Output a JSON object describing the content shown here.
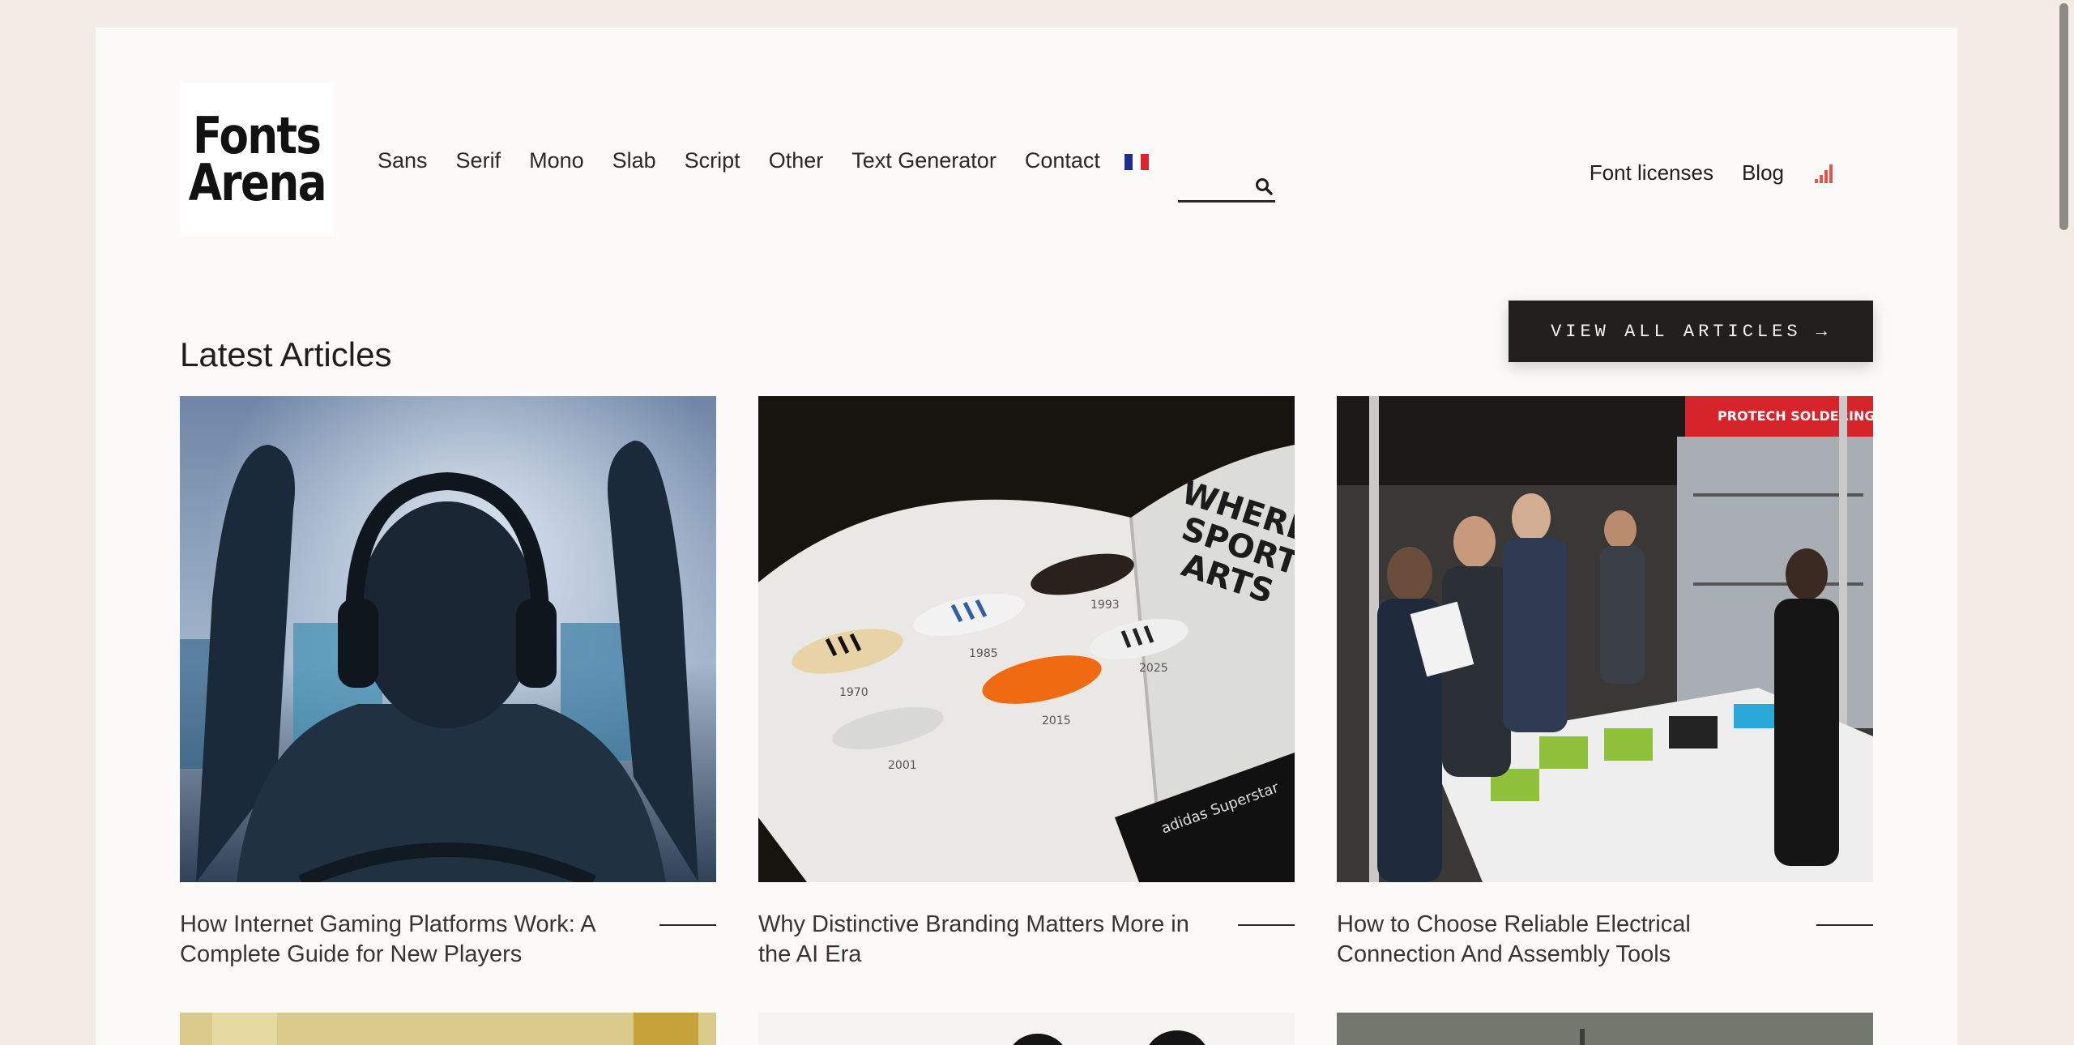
{
  "logo": {
    "line1": "Fonts",
    "line2": "Arena"
  },
  "nav": {
    "items": [
      "Sans",
      "Serif",
      "Mono",
      "Slab",
      "Script",
      "Other",
      "Text Generator",
      "Contact"
    ]
  },
  "language_flag": {
    "icon": "french-flag-icon",
    "colors": [
      "#1e2d8c",
      "#ffffff",
      "#e0222a"
    ]
  },
  "search": {
    "value": "",
    "placeholder": "",
    "icon": "search-icon"
  },
  "right_nav": {
    "font_licenses": "Font licenses",
    "blog": "Blog",
    "rss_icon": "rss-bars-icon",
    "rss_color": "#e2574c"
  },
  "section": {
    "title": "Latest Articles",
    "view_all": "VIEW ALL ARTICLES →"
  },
  "articles": [
    {
      "title": "How Internet Gaming Platforms Work: A Complete Guide for New Players",
      "image": "gamer-with-headphones-image"
    },
    {
      "title": "Why Distinctive Branding Matters More in the AI Era",
      "image": "sneaker-magazine-image"
    },
    {
      "title": "How to Choose Reliable Electrical Connection And Assembly Tools",
      "image": "trade-show-booth-image"
    }
  ],
  "colors": {
    "background": "#f3ece4",
    "page": "#fbfaf8",
    "button": "#231f1f",
    "text": "#1f1d1d"
  }
}
